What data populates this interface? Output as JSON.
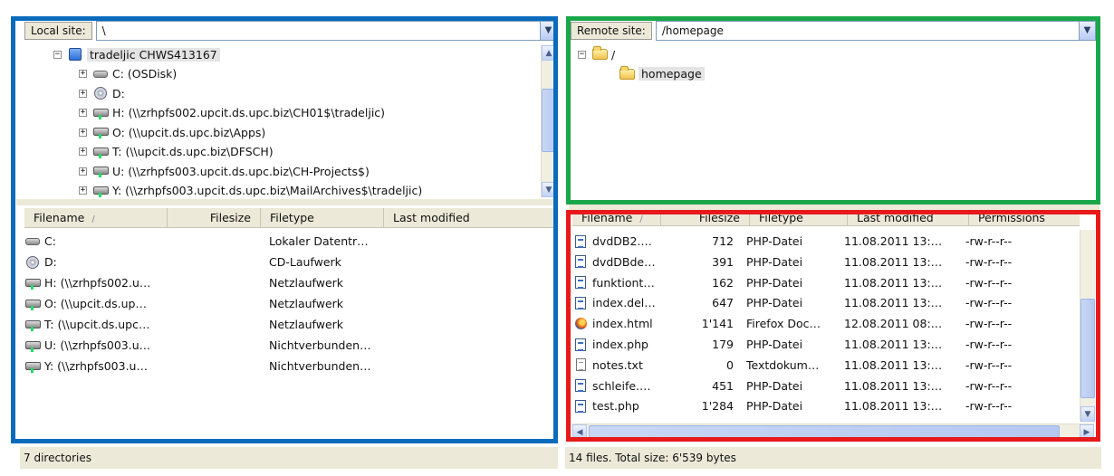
{
  "local": {
    "site_label": "Local site:",
    "site_path": "\\",
    "tree": [
      {
        "indent": 0,
        "toggle": "−",
        "icon": "computer-icon",
        "label": "tradeljic  CHWS413167",
        "selected": true
      },
      {
        "indent": 1,
        "toggle": "+",
        "icon": "hard-drive-icon",
        "label": "C: (OSDisk)"
      },
      {
        "indent": 1,
        "toggle": "+",
        "icon": "cd-drive-icon",
        "label": "D:"
      },
      {
        "indent": 1,
        "toggle": "+",
        "icon": "network-drive-icon",
        "label": "H: (\\\\zrhpfs002.upcit.ds.upc.biz\\CH01$\\tradeljic)"
      },
      {
        "indent": 1,
        "toggle": "+",
        "icon": "network-drive-icon",
        "label": "O: (\\\\upcit.ds.upc.biz\\Apps)"
      },
      {
        "indent": 1,
        "toggle": "+",
        "icon": "network-drive-icon",
        "label": "T: (\\\\upcit.ds.upc.biz\\DFSCH)"
      },
      {
        "indent": 1,
        "toggle": "+",
        "icon": "network-drive-icon",
        "label": "U: (\\\\zrhpfs003.upcit.ds.upc.biz\\CH-Projects$)"
      },
      {
        "indent": 1,
        "toggle": "+",
        "icon": "network-drive-icon",
        "label": "Y: (\\\\zrhpfs003.upcit.ds.upc.biz\\MailArchives$\\tradeljic)"
      }
    ],
    "columns": [
      "Filename",
      "Filesize",
      "Filetype",
      "Last modified"
    ],
    "sort_indicator": "/",
    "files": [
      {
        "icon": "hard-drive-icon",
        "name": "C:",
        "size": "",
        "type": "Lokaler Datentr…",
        "modified": ""
      },
      {
        "icon": "cd-drive-icon",
        "name": "D:",
        "size": "",
        "type": "CD-Laufwerk",
        "modified": ""
      },
      {
        "icon": "network-drive-icon",
        "name": "H: (\\\\zrhpfs002.u…",
        "size": "",
        "type": "Netzlaufwerk",
        "modified": ""
      },
      {
        "icon": "network-drive-icon",
        "name": "O: (\\\\upcit.ds.up…",
        "size": "",
        "type": "Netzlaufwerk",
        "modified": ""
      },
      {
        "icon": "network-drive-icon",
        "name": "T: (\\\\upcit.ds.upc…",
        "size": "",
        "type": "Netzlaufwerk",
        "modified": ""
      },
      {
        "icon": "network-drive-icon",
        "name": "U: (\\\\zrhpfs003.u…",
        "size": "",
        "type": "Nichtverbunden…",
        "modified": ""
      },
      {
        "icon": "network-drive-icon",
        "name": "Y: (\\\\zrhpfs003.u…",
        "size": "",
        "type": "Nichtverbunden…",
        "modified": ""
      }
    ],
    "status": "7 directories"
  },
  "remote": {
    "site_label": "Remote site:",
    "site_path": "/homepage",
    "tree": [
      {
        "indent": 0,
        "toggle": "−",
        "icon": "folder-icon",
        "label": "/"
      },
      {
        "indent": 1,
        "toggle": "",
        "icon": "folder-icon",
        "label": "homepage",
        "selected": true
      }
    ],
    "columns": [
      "Filename",
      "Filesize",
      "Filetype",
      "Last modified",
      "Permissions"
    ],
    "sort_indicator": "/",
    "files": [
      {
        "icon": "php-file-icon",
        "name": "dvdDB2.…",
        "size": "712",
        "type": "PHP-Datei",
        "modified": "11.08.2011 13:…",
        "perms": "-rw-r--r--"
      },
      {
        "icon": "php-file-icon",
        "name": "dvdDBde…",
        "size": "391",
        "type": "PHP-Datei",
        "modified": "11.08.2011 13:…",
        "perms": "-rw-r--r--"
      },
      {
        "icon": "php-file-icon",
        "name": "funktiont…",
        "size": "162",
        "type": "PHP-Datei",
        "modified": "11.08.2011 13:…",
        "perms": "-rw-r--r--"
      },
      {
        "icon": "php-file-icon",
        "name": "index.del…",
        "size": "647",
        "type": "PHP-Datei",
        "modified": "11.08.2011 13:…",
        "perms": "-rw-r--r--"
      },
      {
        "icon": "firefox-file-icon",
        "name": "index.html",
        "size": "1'141",
        "type": "Firefox Doc…",
        "modified": "12.08.2011 08:…",
        "perms": "-rw-r--r--"
      },
      {
        "icon": "php-file-icon",
        "name": "index.php",
        "size": "179",
        "type": "PHP-Datei",
        "modified": "11.08.2011 13:…",
        "perms": "-rw-r--r--"
      },
      {
        "icon": "text-file-icon",
        "name": "notes.txt",
        "size": "0",
        "type": "Textdokum…",
        "modified": "11.08.2011 13:…",
        "perms": "-rw-r--r--"
      },
      {
        "icon": "php-file-icon",
        "name": "schleife.…",
        "size": "451",
        "type": "PHP-Datei",
        "modified": "11.08.2011 13:…",
        "perms": "-rw-r--r--"
      },
      {
        "icon": "php-file-icon",
        "name": "test.php",
        "size": "1'284",
        "type": "PHP-Datei",
        "modified": "11.08.2011 13:…",
        "perms": "-rw-r--r--"
      }
    ],
    "status": "14 files. Total size: 6'539 bytes"
  },
  "colors": {
    "highlight_blue": "#0a6bbd",
    "highlight_green": "#19a74a",
    "highlight_red": "#e8191b"
  }
}
